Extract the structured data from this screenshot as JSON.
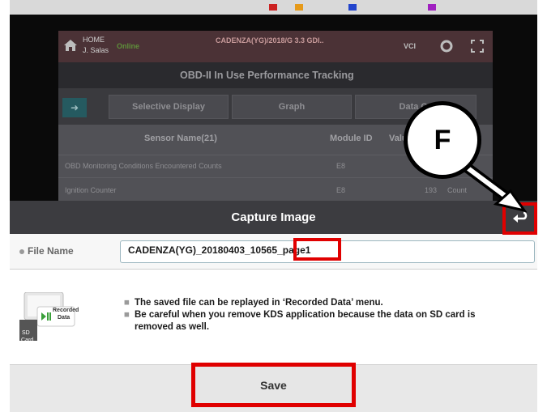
{
  "app": {
    "home_label": "HOME",
    "user_name": "J. Salas",
    "status": "Online",
    "vehicle": "CADENZA(YG)/2018/G 3.3 GDI..",
    "vci_label": "VCI",
    "screen_title": "OBD-II In Use Performance Tracking",
    "tabs": [
      "Selective Display",
      "Graph",
      "Data Ca"
    ],
    "table": {
      "headers": [
        "Sensor Name(21)",
        "Module ID",
        "Valu"
      ],
      "rows": [
        {
          "name": "OBD Monitoring Conditions Encountered Counts",
          "module": "E8",
          "value": "",
          "unit": ""
        },
        {
          "name": "Ignition Counter",
          "module": "E8",
          "value": "193",
          "unit": "Count"
        }
      ]
    }
  },
  "dialog": {
    "title": "Capture Image",
    "file_name_label": "File Name",
    "file_name_main": "CADENZA(YG)_20180403_10565",
    "file_name_suffix": "_page1",
    "bullets": [
      "The saved file can be replayed in ‘Recorded Data’ menu.",
      "Be careful when you remove KDS application because the data on SD card is",
      "removed as well."
    ],
    "illustration_text": [
      "Recorded",
      "Data",
      "SD",
      "Card"
    ],
    "save_label": "Save"
  },
  "callout": {
    "letter": "F"
  },
  "colors": {
    "highlight": "#e00000",
    "dialog_bar": "#3c3c40",
    "app_header": "#4b3236"
  },
  "icons": [
    "home-icon",
    "back-arrow-icon",
    "vci-icon",
    "settings-icon",
    "fullscreen-icon",
    "arrow-right-icon"
  ]
}
